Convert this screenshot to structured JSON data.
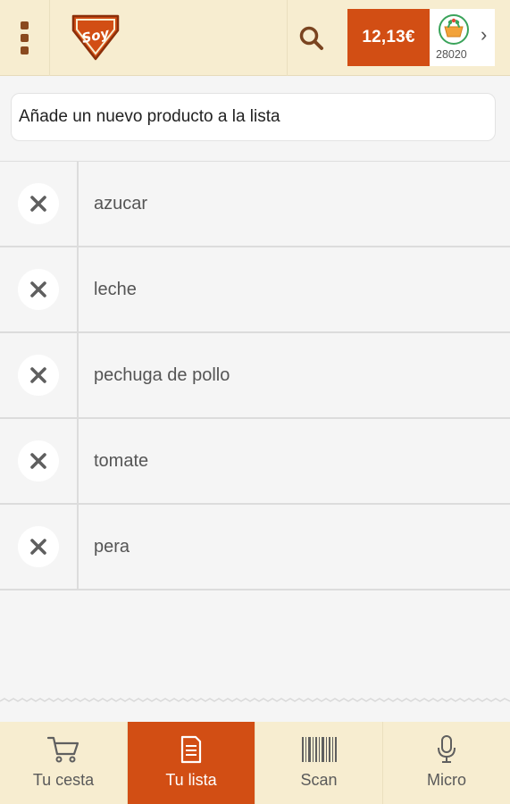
{
  "header": {
    "menu_icon": "menu-dots-icon",
    "logo_text": "Soy",
    "search_icon": "search-icon",
    "cart_total": "12,13€",
    "store": {
      "icon": "basket-icon",
      "postal_code": "28020",
      "chevron": "›"
    }
  },
  "add_item": {
    "placeholder": "Añade un nuevo producto a la lista"
  },
  "list": {
    "items": [
      {
        "label": "azucar"
      },
      {
        "label": "leche"
      },
      {
        "label": "pechuga de pollo"
      },
      {
        "label": "tomate"
      },
      {
        "label": "pera"
      }
    ]
  },
  "nav": {
    "items": [
      {
        "label": "Tu cesta",
        "icon": "cart-icon",
        "active": false
      },
      {
        "label": "Tu lista",
        "icon": "list-document-icon",
        "active": true
      },
      {
        "label": "Scan",
        "icon": "barcode-icon",
        "active": false
      },
      {
        "label": "Micro",
        "icon": "microphone-icon",
        "active": false
      }
    ]
  },
  "colors": {
    "accent": "#d24e14",
    "header_bg": "#f7edd0",
    "list_bg": "#f5f5f5",
    "brand_brown": "#8a4a1f"
  }
}
